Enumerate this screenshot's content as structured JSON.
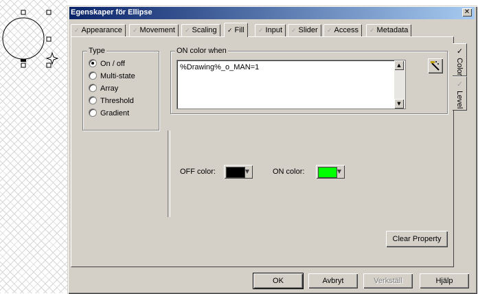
{
  "dialog": {
    "title": "Egenskaper för Ellipse",
    "close_glyph": "✕"
  },
  "tabs": [
    {
      "label": "Appearance",
      "active": false
    },
    {
      "label": "Movement",
      "active": false
    },
    {
      "label": "Scaling",
      "active": false
    },
    {
      "label": "Fill",
      "active": true
    },
    {
      "label": "Input",
      "active": false
    },
    {
      "label": "Slider",
      "active": false
    },
    {
      "label": "Access",
      "active": false
    },
    {
      "label": "Metadata",
      "active": false
    }
  ],
  "tab_check_glyph": "✓",
  "side_tabs": [
    {
      "label": "Color",
      "active": true
    },
    {
      "label": "Level",
      "active": false
    }
  ],
  "type_group": {
    "legend": "Type",
    "options": [
      {
        "label": "On / off",
        "selected": true
      },
      {
        "label": "Multi-state",
        "selected": false
      },
      {
        "label": "Array",
        "selected": false
      },
      {
        "label": "Threshold",
        "selected": false
      },
      {
        "label": "Gradient",
        "selected": false
      }
    ]
  },
  "on_color_group": {
    "legend": "ON color when",
    "expression": "%Drawing%_o_MAN=1",
    "wand_icon": "magic-wand-icon"
  },
  "colors": {
    "off_label": "OFF color:",
    "off_value": "#000000",
    "on_label": "ON color:",
    "on_value": "#00ff00"
  },
  "clear_property_label": "Clear Property",
  "footer": {
    "ok_label": "OK",
    "cancel_label": "Avbryt",
    "apply_label": "Verkställ",
    "help_label": "Hjälp"
  },
  "theme": {
    "dialog_bg": "#d4d0c8",
    "titlebar_start": "#0a246a",
    "titlebar_end": "#a6caf0"
  }
}
